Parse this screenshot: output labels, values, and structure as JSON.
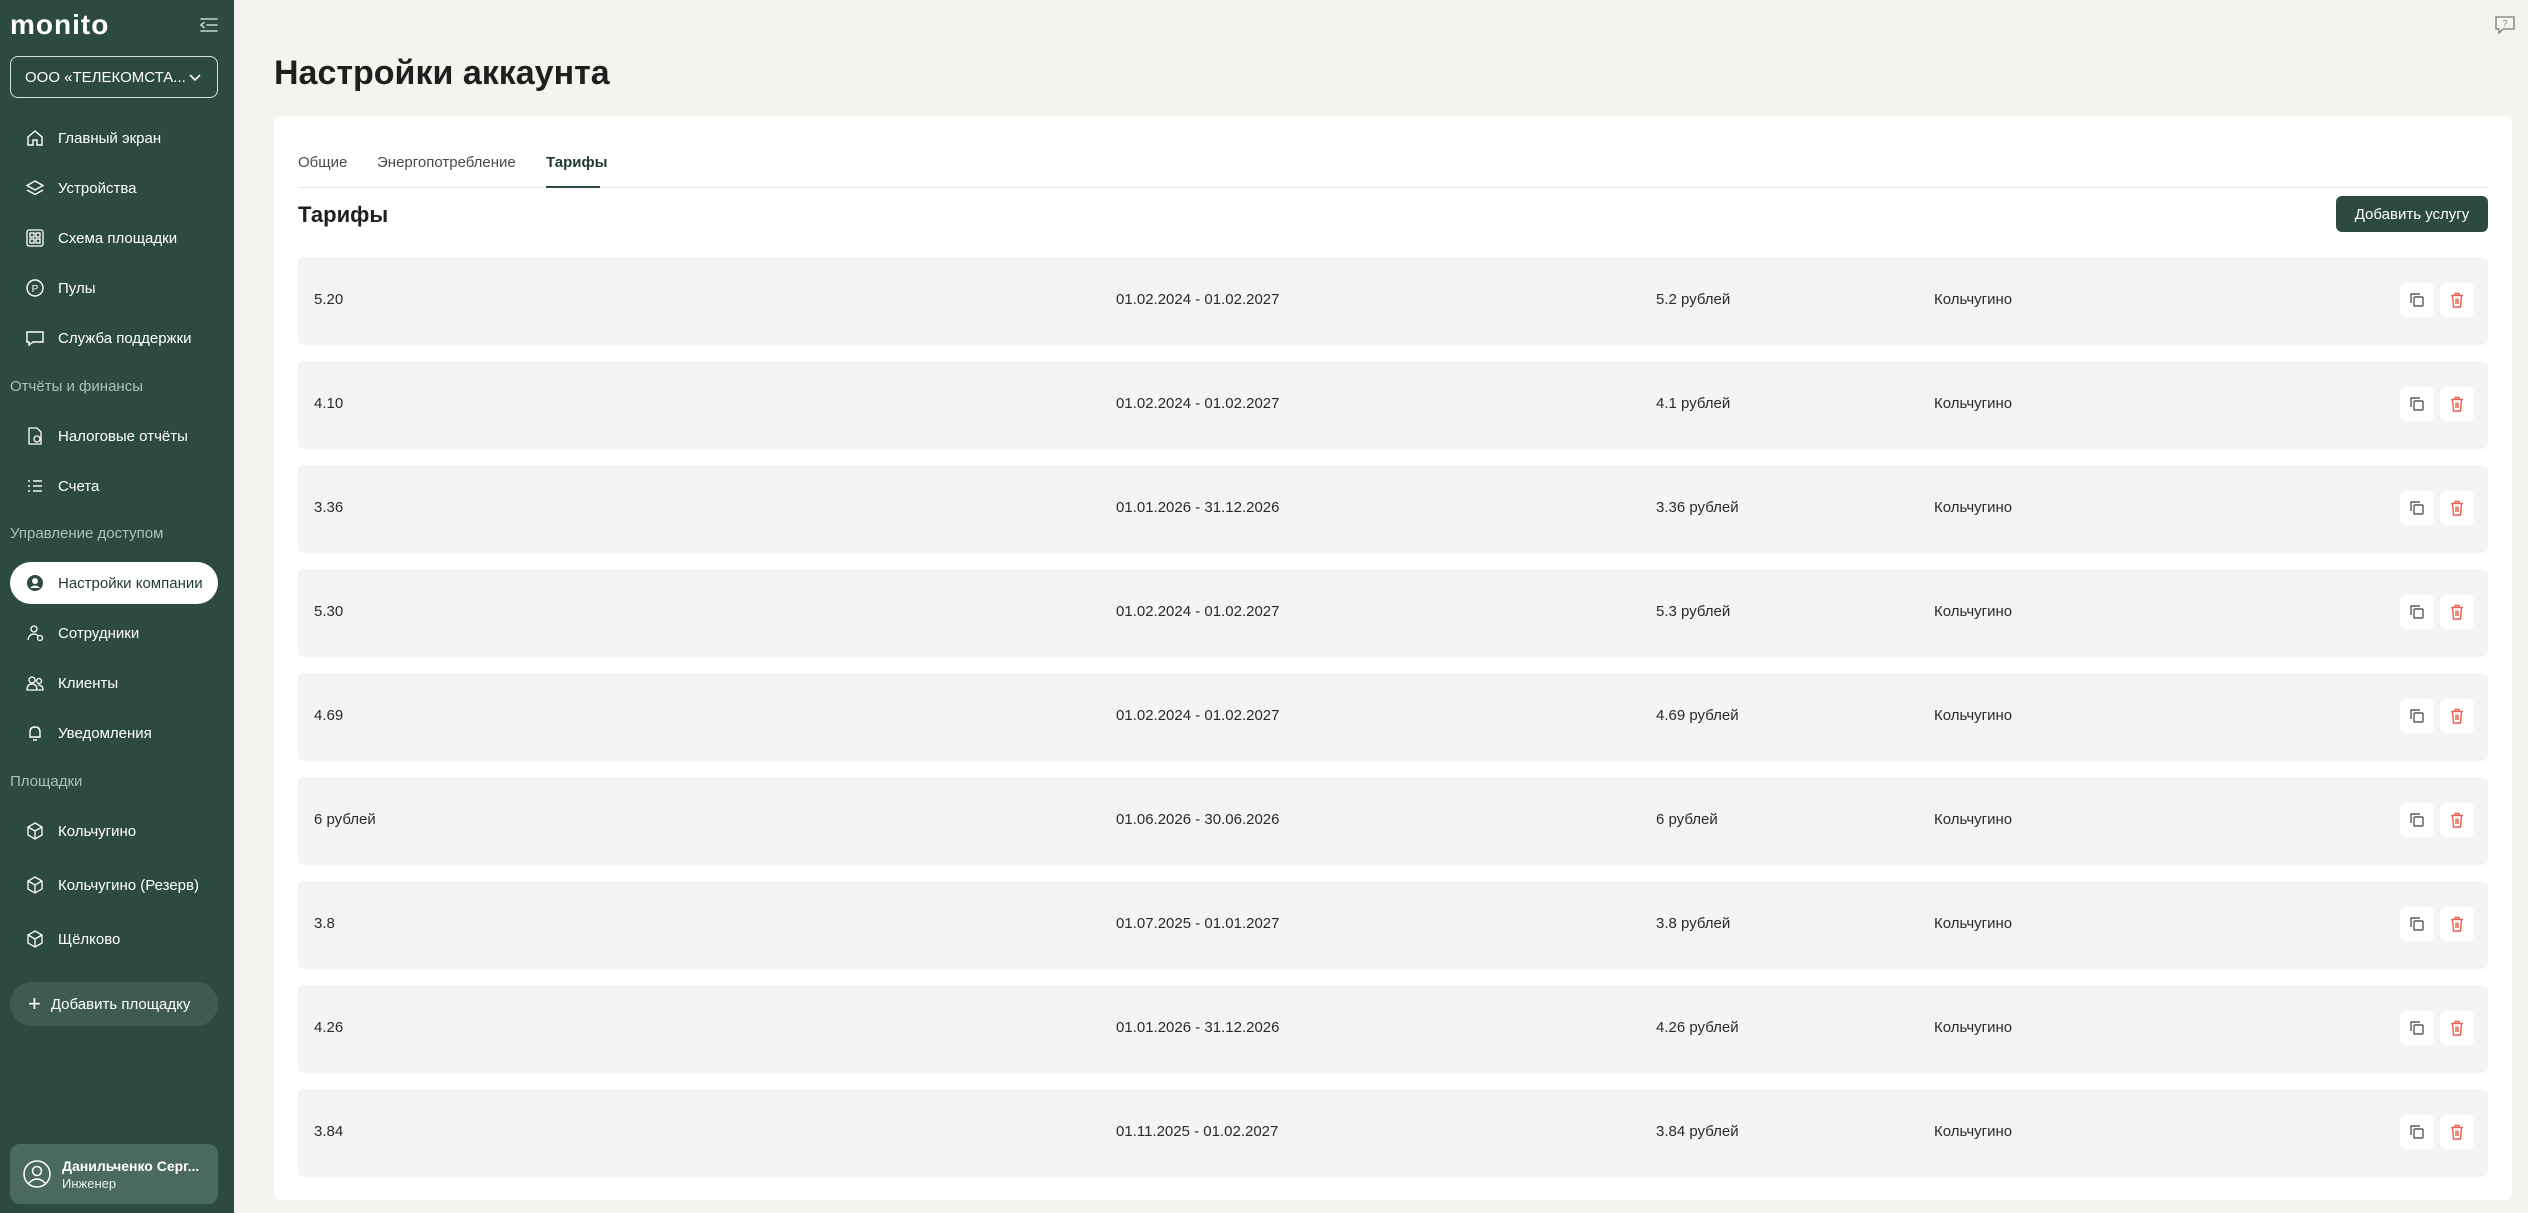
{
  "sidebar": {
    "logo": "monito",
    "org_select": "ООО «ТЕЛЕКОМСТА...",
    "nav": [
      {
        "label": "Главный экран",
        "icon": "home-icon"
      },
      {
        "label": "Устройства",
        "icon": "layers-icon"
      },
      {
        "label": "Схема площадки",
        "icon": "grid-icon"
      },
      {
        "label": "Пулы",
        "icon": "pool-icon"
      },
      {
        "label": "Служба поддержки",
        "icon": "chat-icon"
      }
    ],
    "section_reports": "Отчёты и финансы",
    "reports": [
      {
        "label": "Налоговые отчёты",
        "icon": "tax-report-icon"
      },
      {
        "label": "Счета",
        "icon": "list-icon"
      }
    ],
    "section_access": "Управление доступом",
    "access": [
      {
        "label": "Настройки компании",
        "icon": "user-circle-icon"
      },
      {
        "label": "Сотрудники",
        "icon": "employees-icon"
      },
      {
        "label": "Клиенты",
        "icon": "clients-icon"
      },
      {
        "label": "Уведомления",
        "icon": "bell-icon"
      }
    ],
    "section_sites": "Площадки",
    "sites": [
      {
        "label": "Кольчугино",
        "icon": "cube-icon"
      },
      {
        "label": "Кольчугино (Резерв)",
        "icon": "cube-icon"
      },
      {
        "label": "Щёлково",
        "icon": "cube-icon"
      }
    ],
    "add_site": "Добавить площадку",
    "user": {
      "name": "Данильченко Серг...",
      "role": "Инженер"
    }
  },
  "page": {
    "title": "Настройки аккаунта",
    "tabs": [
      {
        "label": "Общие"
      },
      {
        "label": "Энергопотребление"
      },
      {
        "label": "Тарифы"
      }
    ],
    "active_tab": "Тарифы",
    "section_title": "Тарифы",
    "add_service": "Добавить услугу"
  },
  "tariffs": [
    {
      "name": "5.20",
      "period": "01.02.2024 - 01.02.2027",
      "price": "5.2 рублей",
      "site": "Кольчугино"
    },
    {
      "name": "4.10",
      "period": "01.02.2024 - 01.02.2027",
      "price": "4.1 рублей",
      "site": "Кольчугино"
    },
    {
      "name": "3.36",
      "period": "01.01.2026 - 31.12.2026",
      "price": "3.36 рублей",
      "site": "Кольчугино"
    },
    {
      "name": "5.30",
      "period": "01.02.2024 - 01.02.2027",
      "price": "5.3 рублей",
      "site": "Кольчугино"
    },
    {
      "name": "4.69",
      "period": "01.02.2024 - 01.02.2027",
      "price": "4.69 рублей",
      "site": "Кольчугино"
    },
    {
      "name": "6 рублей",
      "period": "01.06.2026 - 30.06.2026",
      "price": "6 рублей",
      "site": "Кольчугино"
    },
    {
      "name": "3.8",
      "period": "01.07.2025 - 01.01.2027",
      "price": "3.8 рублей",
      "site": "Кольчугино"
    },
    {
      "name": "4.26",
      "period": "01.01.2026 - 31.12.2026",
      "price": "4.26 рублей",
      "site": "Кольчугино"
    },
    {
      "name": "3.84",
      "period": "01.11.2025 - 01.02.2027",
      "price": "3.84 рублей",
      "site": "Кольчугино"
    }
  ],
  "colors": {
    "sidebar_bg": "#2d4a40",
    "accent": "#2d4a40",
    "page_bg": "#f4f4ef",
    "row_bg": "#f4f4f2",
    "delete": "#e0604a"
  }
}
